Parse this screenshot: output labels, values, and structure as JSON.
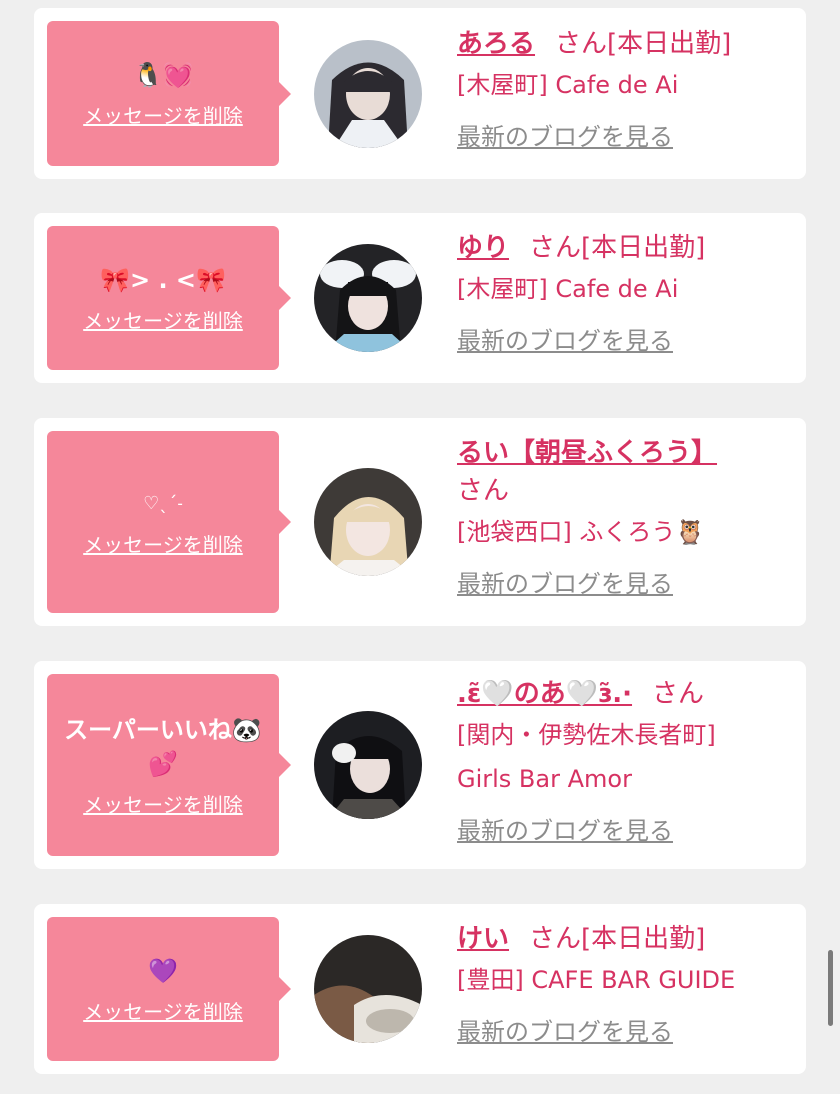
{
  "cards": [
    {
      "message": "🐧💓",
      "delete_label": "メッセージを削除",
      "name": "あろる",
      "suffix": "さん",
      "status": "[本日出勤]",
      "shop": "[木屋町] Cafe de Ai",
      "blog_label": "最新のブログを見る"
    },
    {
      "message": "🎀> . <🎀",
      "delete_label": "メッセージを削除",
      "name": "ゆり",
      "suffix": "さん",
      "status": "[本日出勤]",
      "shop": "[木屋町] Cafe de Ai",
      "blog_label": "最新のブログを見る"
    },
    {
      "message": "♡ˎˊ˗",
      "delete_label": "メッセージを削除",
      "name": "るい【朝昼ふくろう】",
      "suffix": "さん",
      "status": "",
      "shop": "[池袋西口] ふくろう🦉",
      "blog_label": "最新のブログを見る"
    },
    {
      "message": "スーパーいいね🐼💕",
      "delete_label": "メッセージを削除",
      "name": ".ɛ̃🤍のあ🤍ɜ̃.·",
      "suffix": "さん",
      "status": "",
      "shop": "[関内・伊勢佐木長者町] Girls Bar Amor",
      "blog_label": "最新のブログを見る"
    },
    {
      "message": "💜",
      "delete_label": "メッセージを削除",
      "name": "けい",
      "suffix": "さん",
      "status": "[本日出勤]",
      "shop": "[豊田] CAFE BAR GUIDE",
      "blog_label": "最新のブログを見る"
    }
  ]
}
